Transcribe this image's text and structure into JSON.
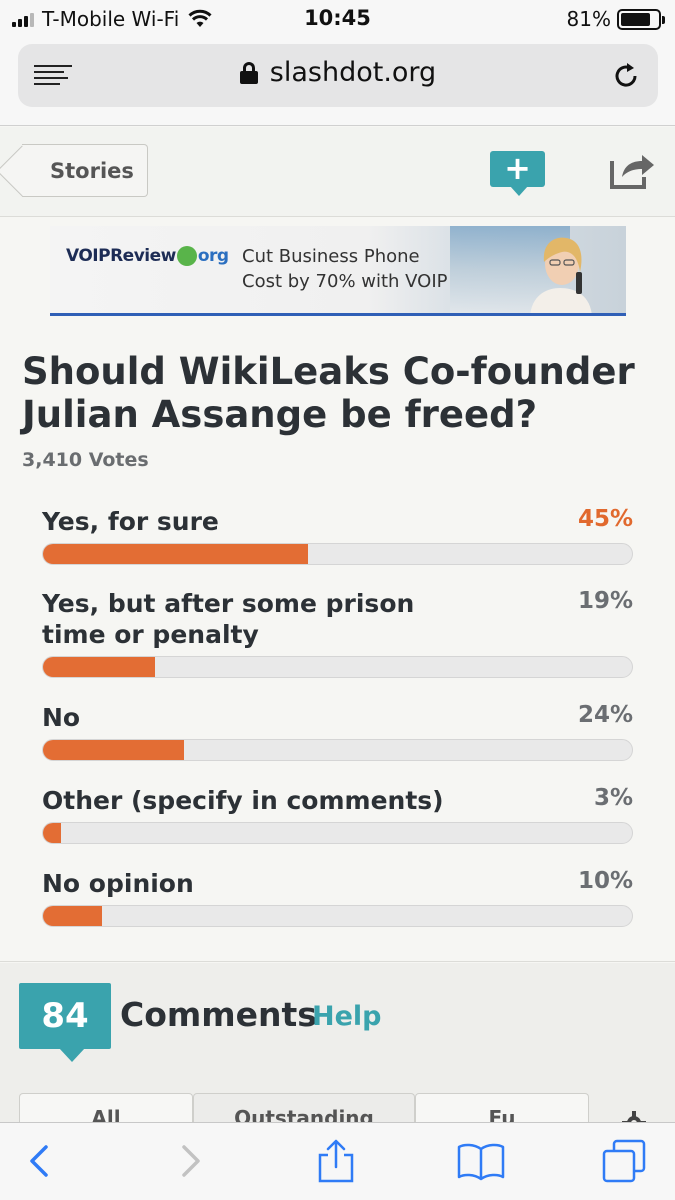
{
  "status_bar": {
    "carrier": "T-Mobile Wi-Fi",
    "time": "10:45",
    "battery": "81%",
    "battery_level": 0.81
  },
  "browser": {
    "url": "slashdot.org"
  },
  "header": {
    "back_label": "Stories",
    "add_label": "+"
  },
  "ad": {
    "logo_main": "VOIPReview",
    "logo_suffix": "org",
    "line1": "Cut Business Phone",
    "line2": "Cost by 70% with VOIP"
  },
  "poll": {
    "question": "Should WikiLeaks Co-founder Julian Assange be freed?",
    "votes": "3,410 Votes",
    "options": [
      {
        "label": "Yes, for sure",
        "pct": "45%",
        "value": 45
      },
      {
        "label": "Yes, but after some prison time or penalty",
        "pct": "19%",
        "value": 19
      },
      {
        "label": "No",
        "pct": "24%",
        "value": 24
      },
      {
        "label": "Other (specify in comments)",
        "pct": "3%",
        "value": 3
      },
      {
        "label": "No opinion",
        "pct": "10%",
        "value": 10
      }
    ]
  },
  "comments": {
    "count": "84",
    "title": "Comments",
    "help": "Help",
    "tabs": [
      "All",
      "Outstanding",
      "Fu"
    ]
  },
  "colors": {
    "accent": "#3aa3ad",
    "bar_fill": "#e36d34",
    "lead_pct": "#e1692e"
  }
}
